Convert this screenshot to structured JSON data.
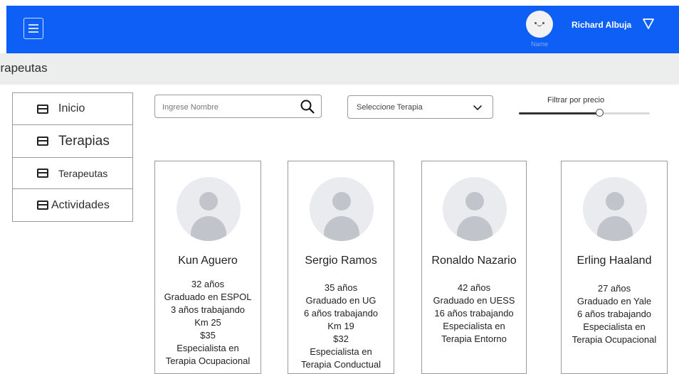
{
  "header": {
    "avatar_caption": "Name",
    "user_name": "Richard Albuja"
  },
  "breadcrumb": "erapeutas",
  "sidebar": {
    "items": [
      {
        "label": "Inicio"
      },
      {
        "label": "Terapias"
      },
      {
        "label": "Terapeutas"
      },
      {
        "label": "Actividades"
      }
    ]
  },
  "filters": {
    "search_placeholder": "Ingrese Nombre",
    "therapy_select": "Seleccione Terapia",
    "price_label": "Filtrar por precio",
    "price_level": 0.62
  },
  "therapists": [
    {
      "name": "Kun Aguero",
      "age": "32 años",
      "education": "Graduado en ESPOL",
      "experience": "3 años trabajando",
      "distance": "Km 25",
      "price": "$35",
      "specialty_line1": "Especialista en",
      "specialty_line2": "Terapia Ocupacional"
    },
    {
      "name": "Sergio Ramos",
      "age": "35 años",
      "education": "Graduado en UG",
      "experience": "6 años trabajando",
      "distance": "Km 19",
      "price": "$32",
      "specialty_line1": "Especialista en",
      "specialty_line2": "Terapia Conductual"
    },
    {
      "name": "Ronaldo Nazario",
      "age": "42 años",
      "education": "Graduado en UESS",
      "experience": "16 años trabajando",
      "specialty_line1": "Especialista en",
      "specialty_line2": "Terapia Entorno"
    },
    {
      "name": "Erling Haaland",
      "age": "27 años",
      "education": "Graduado en Yale",
      "experience": "6 años trabajando",
      "specialty_line1": "Especialista en",
      "specialty_line2": "Terapia Ocupacional"
    }
  ]
}
